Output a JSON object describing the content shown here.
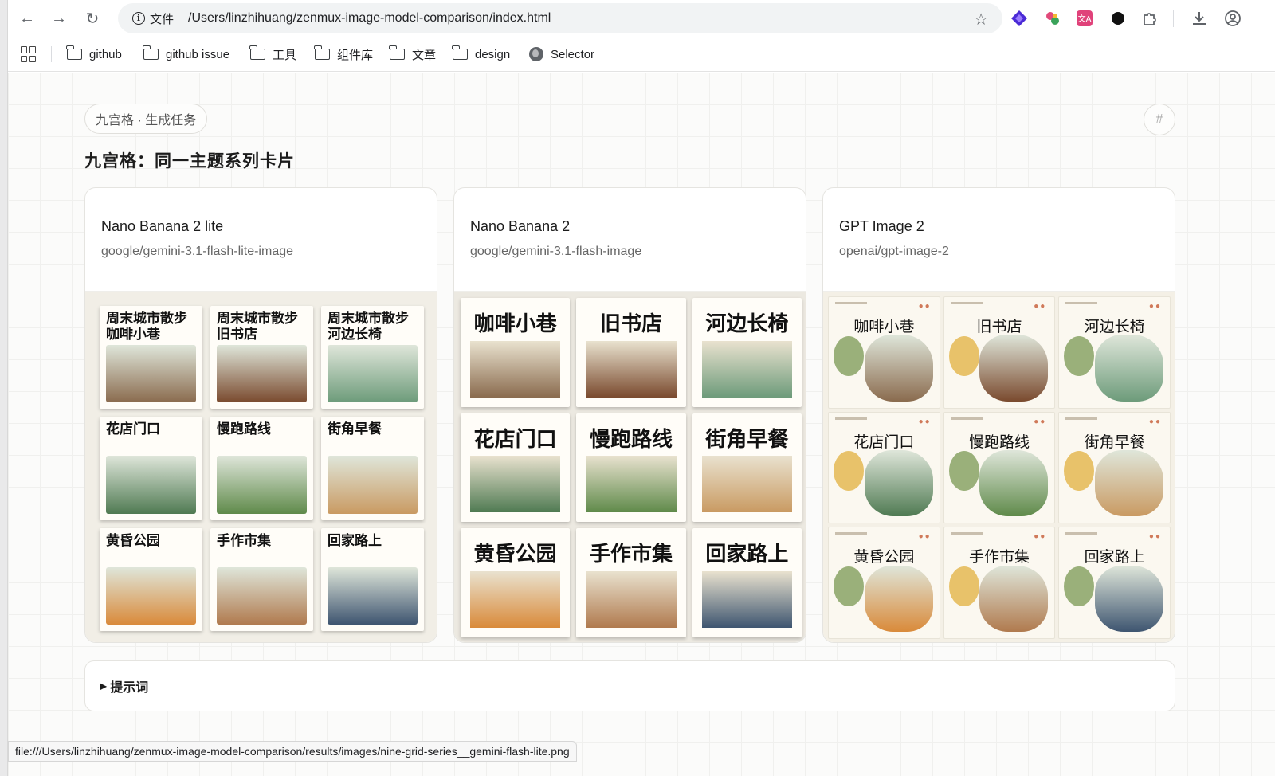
{
  "browser": {
    "site_info_label": "文件",
    "url": "/Users/linzhihuang/zenmux-image-model-comparison/index.html"
  },
  "bookmarks": [
    "github",
    "github issue",
    "工具",
    "组件库",
    "文章",
    "design",
    "Selector"
  ],
  "page": {
    "tag_pill": "九宫格 · 生成任务",
    "hash_label": "#",
    "title": "九宫格：同一主题系列卡片"
  },
  "cards": [
    {
      "name": "Nano Banana 2 lite",
      "model": "google/gemini-3.1-flash-lite-image",
      "tiles": [
        "周末城市散步\n咖啡小巷",
        "周末城市散步\n旧书店",
        "周末城市散步\n河边长椅",
        "花店门口",
        "慢跑路线",
        "街角早餐",
        "黄昏公园",
        "手作市集",
        "回家路上"
      ]
    },
    {
      "name": "Nano Banana 2",
      "model": "google/gemini-3.1-flash-image",
      "tiles": [
        "咖啡小巷",
        "旧书店",
        "河边长椅",
        "花店门口",
        "慢跑路线",
        "街角早餐",
        "黄昏公园",
        "手作市集",
        "回家路上"
      ]
    },
    {
      "name": "GPT Image 2",
      "model": "openai/gpt-image-2",
      "tiles": [
        "咖啡小巷",
        "旧书店",
        "河边长椅",
        "花店门口",
        "慢跑路线",
        "街角早餐",
        "黄昏公园",
        "手作市集",
        "回家路上"
      ]
    }
  ],
  "prompt_toggle": "提示词",
  "status_bar": "file:///Users/linzhihuang/zenmux-image-model-comparison/results/images/nine-grid-series__gemini-flash-lite.png",
  "colors": {
    "scene": [
      "#8a6b4e",
      "#7a4a2e",
      "#6d9b7a",
      "#4f7a52",
      "#5f8a4a",
      "#c99a62",
      "#d98a3a",
      "#b07a4e",
      "#3e5570"
    ]
  }
}
